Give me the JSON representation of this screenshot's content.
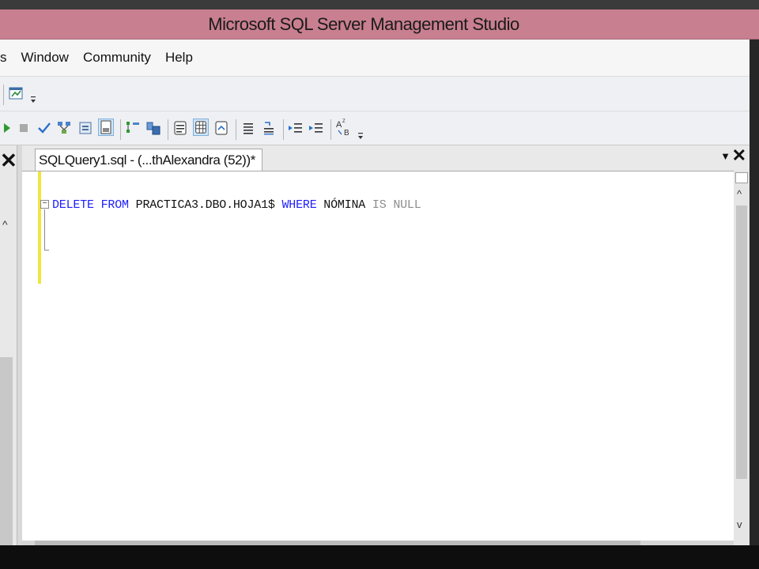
{
  "window": {
    "title": "Microsoft SQL Server Management Studio"
  },
  "menu": {
    "items": [
      "s",
      "Window",
      "Community",
      "Help"
    ]
  },
  "document": {
    "tab_label": "SQLQuery1.sql - (...thAlexandra (52))*",
    "code_line": {
      "t1": "DELETE",
      "t2": " ",
      "t3": "FROM",
      "t4": " PRACTICA3.DBO.HOJA1$ ",
      "t5": "WHERE",
      "t6": " NÓMINA ",
      "t7": "IS NULL"
    }
  },
  "icons": {
    "toolbar1": [
      "chart-icon",
      "dropdown-icon"
    ],
    "toolbar2": [
      "execute-icon",
      "stop-icon",
      "parse-icon",
      "display-plan-icon",
      "query-designer-icon",
      "results-to-file-icon",
      "include-plan-icon",
      "client-stats-icon",
      "results-text-icon",
      "results-grid-icon",
      "results-file-icon",
      "comment-icon",
      "uncomment-icon",
      "decrease-indent-icon",
      "increase-indent-icon",
      "specify-values-icon"
    ]
  },
  "colors": {
    "titlebar": "#c87f8f",
    "keyword": "#1e1eff",
    "gray_keyword": "#8c8c8c",
    "change_indicator": "#f2e440"
  }
}
